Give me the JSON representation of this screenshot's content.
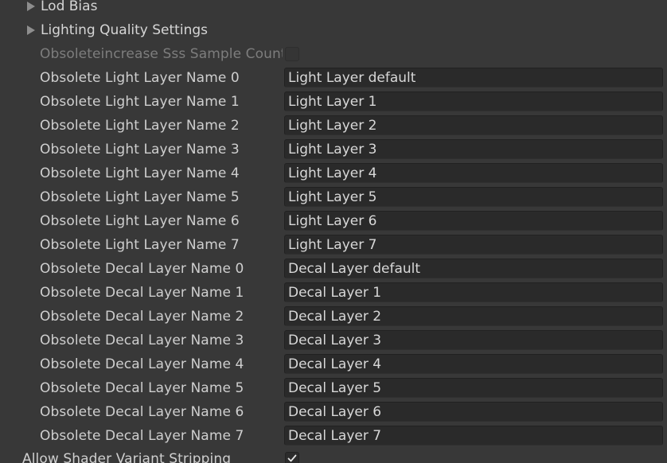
{
  "foldouts": [
    {
      "label": "Lod Bias"
    },
    {
      "label": "Lighting Quality Settings"
    }
  ],
  "sss_row": {
    "label": "Obsoleteincrease Sss Sample Count",
    "checked": false,
    "disabled": true
  },
  "light_layers": [
    {
      "label": "Obsolete Light Layer Name 0",
      "value": "Light Layer default"
    },
    {
      "label": "Obsolete Light Layer Name 1",
      "value": "Light Layer 1"
    },
    {
      "label": "Obsolete Light Layer Name 2",
      "value": "Light Layer 2"
    },
    {
      "label": "Obsolete Light Layer Name 3",
      "value": "Light Layer 3"
    },
    {
      "label": "Obsolete Light Layer Name 4",
      "value": "Light Layer 4"
    },
    {
      "label": "Obsolete Light Layer Name 5",
      "value": "Light Layer 5"
    },
    {
      "label": "Obsolete Light Layer Name 6",
      "value": "Light Layer 6"
    },
    {
      "label": "Obsolete Light Layer Name 7",
      "value": "Light Layer 7"
    }
  ],
  "decal_layers": [
    {
      "label": "Obsolete Decal Layer Name 0",
      "value": "Decal Layer default"
    },
    {
      "label": "Obsolete Decal Layer Name 1",
      "value": "Decal Layer 1"
    },
    {
      "label": "Obsolete Decal Layer Name 2",
      "value": "Decal Layer 2"
    },
    {
      "label": "Obsolete Decal Layer Name 3",
      "value": "Decal Layer 3"
    },
    {
      "label": "Obsolete Decal Layer Name 4",
      "value": "Decal Layer 4"
    },
    {
      "label": "Obsolete Decal Layer Name 5",
      "value": "Decal Layer 5"
    },
    {
      "label": "Obsolete Decal Layer Name 6",
      "value": "Decal Layer 6"
    },
    {
      "label": "Obsolete Decal Layer Name 7",
      "value": "Decal Layer 7"
    }
  ],
  "shader_stripping": {
    "label": "Allow Shader Variant Stripping",
    "checked": true
  },
  "icons": {
    "foldout": "triangle-right-icon",
    "checkmark": "checkmark-icon"
  },
  "colors": {
    "background": "#383838",
    "field_background": "#2a2a2a",
    "label_text": "#cfcfcf",
    "disabled_text": "#7d7d7d"
  }
}
